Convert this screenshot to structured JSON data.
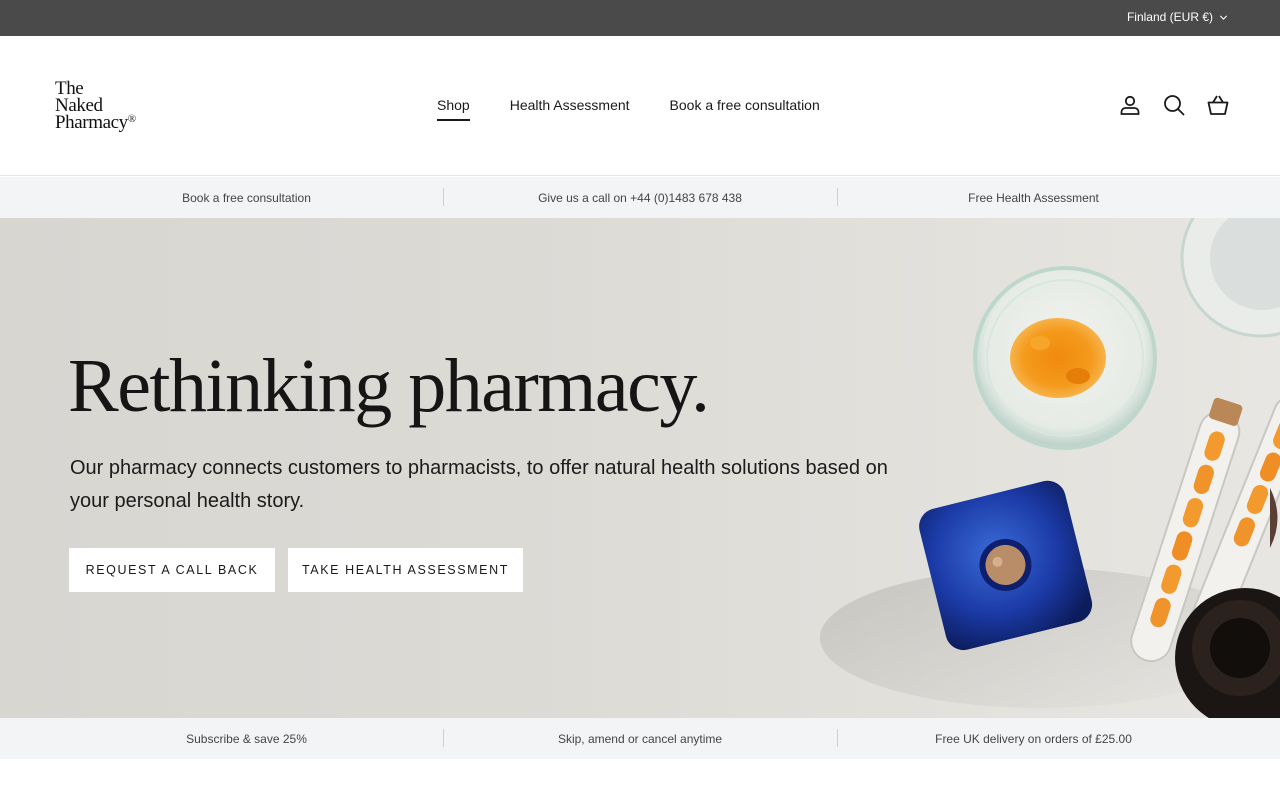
{
  "topbar": {
    "currency_label": "Finland (EUR €)"
  },
  "header": {
    "logo": {
      "line1": "The",
      "line2": "Naked",
      "line3": "Pharmacy",
      "mark": "®"
    },
    "nav": [
      {
        "label": "Shop",
        "active": true
      },
      {
        "label": "Health Assessment",
        "active": false
      },
      {
        "label": "Book a free consultation",
        "active": false
      }
    ],
    "icons": [
      "account-icon",
      "search-icon",
      "basket-icon"
    ]
  },
  "top_strip": {
    "items": [
      "Book a free consultation",
      "Give us a call on +44 (0)1483 678 438",
      "Free Health Assessment"
    ]
  },
  "hero": {
    "title": "Rethinking pharmacy.",
    "subtitle": "Our pharmacy connects customers to pharmacists, to offer natural health solutions based on your personal health story.",
    "buttons": [
      "REQUEST A CALL BACK",
      "TAKE HEALTH ASSESSMENT"
    ]
  },
  "bottom_strip": {
    "items": [
      "Subscribe & save 25%",
      "Skip, amend or cancel anytime",
      "Free UK delivery on orders of £25.00"
    ]
  },
  "colors": {
    "topbar": "#4a4a4a",
    "strip": "#f3f4f6",
    "hero_bg": "#dcdad5",
    "text": "#1a1a1a"
  }
}
